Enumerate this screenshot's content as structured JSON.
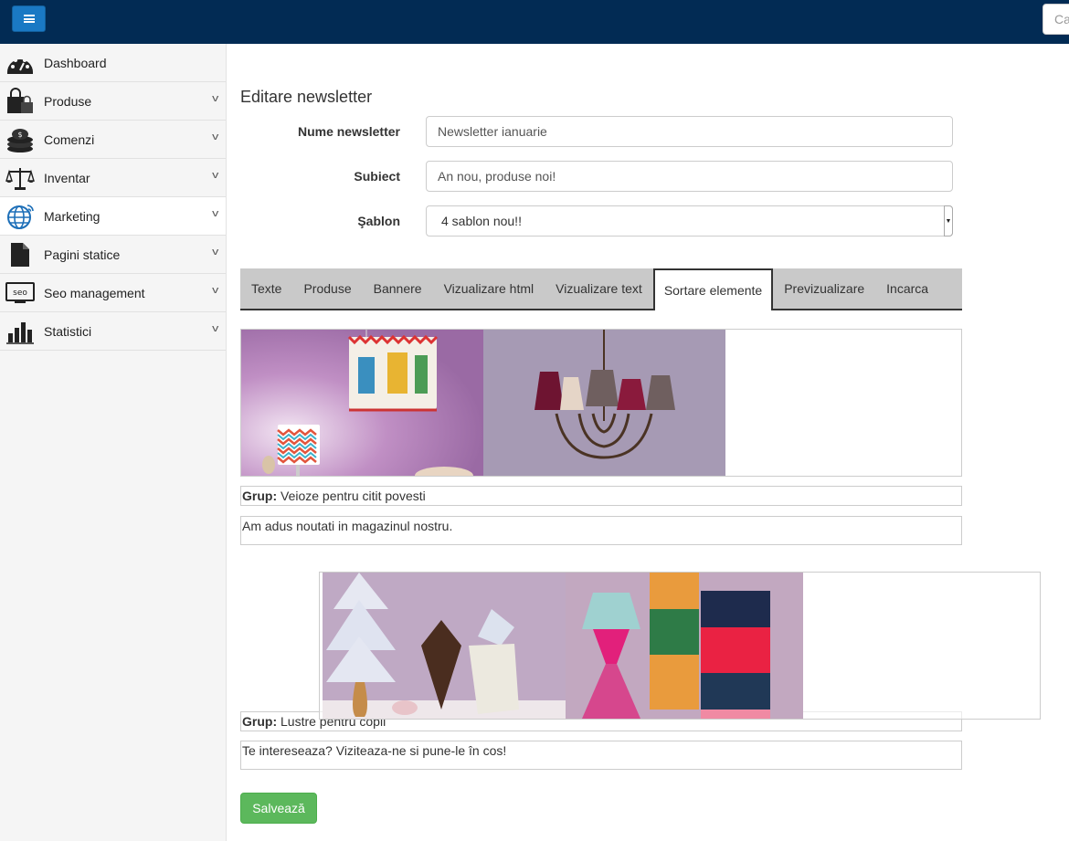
{
  "topbar": {
    "menu_icon": "hamburger-icon",
    "search_placeholder": "Ca"
  },
  "sidebar": {
    "items": [
      {
        "label": "Dashboard",
        "icon": "dashboard-icon"
      },
      {
        "label": "Produse",
        "icon": "shopping-bags-icon"
      },
      {
        "label": "Comenzi",
        "icon": "coins-icon"
      },
      {
        "label": "Inventar",
        "icon": "scale-icon"
      },
      {
        "label": "Marketing",
        "icon": "globe-icon"
      },
      {
        "label": "Pagini statice",
        "icon": "page-icon"
      },
      {
        "label": "Seo management",
        "icon": "seo-monitor-icon"
      },
      {
        "label": "Statistici",
        "icon": "bar-chart-icon"
      }
    ]
  },
  "form": {
    "title": "Editare newsletter",
    "name_label": "Nume newsletter",
    "name_value": "Newsletter ianuarie",
    "subject_label": "Subiect",
    "subject_value": "An nou, produse noi!",
    "template_label": "Şablon",
    "template_value": "4 sablon nou!!"
  },
  "tabs": [
    "Texte",
    "Produse",
    "Bannere",
    "Vizualizare html",
    "Vizualizare text",
    "Sortare elemente",
    "Previzualizare",
    "Incarca"
  ],
  "active_tab": "Sortare elemente",
  "groups": [
    {
      "grup_label": "Grup:",
      "grup_name": "Veioze pentru citit povesti",
      "text": "Am adus noutati in magazinul nostru."
    },
    {
      "grup_label": "Grup:",
      "grup_name": "Lustre pentru copii",
      "text": "Te intereseaza? Viziteaza-ne si pune-le în cos!"
    }
  ],
  "save_label": "Salvează",
  "colors": {
    "topbar": "#022b54",
    "menu_button": "#1a79c4",
    "save_button": "#5cb85c",
    "tab_bar": "#c9c9c9"
  }
}
